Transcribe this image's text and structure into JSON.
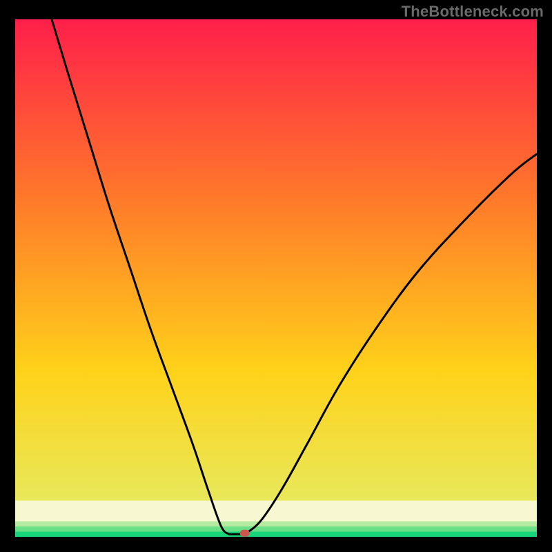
{
  "watermark": "TheBottleneck.com",
  "colors": {
    "black": "#000000",
    "curve": "#000000",
    "marker_fill": "#c8584e",
    "band_cream": "#f7f7d2",
    "band_green": "#17d57a",
    "grad_top": "#ff1f4a",
    "grad_mid1": "#ff7a2a",
    "grad_mid2": "#ffd21a",
    "grad_low": "#e8e85a"
  },
  "chart_data": {
    "type": "line",
    "title": "",
    "xlabel": "",
    "ylabel": "",
    "xlim": [
      0,
      100
    ],
    "ylim": [
      0,
      100
    ],
    "series": [
      {
        "name": "bottleneck-curve-left",
        "x": [
          7,
          10,
          14,
          18,
          22,
          26,
          30,
          34,
          37,
          39.5,
          41
        ],
        "y": [
          100,
          90,
          77,
          64,
          52,
          40,
          29,
          18,
          9,
          2,
          0.5
        ]
      },
      {
        "name": "bottleneck-curve-right",
        "x": [
          44,
          47,
          51,
          56,
          62,
          69,
          77,
          86,
          95,
          100
        ],
        "y": [
          0.5,
          3,
          9,
          18,
          29,
          40,
          51,
          61,
          70,
          74
        ]
      },
      {
        "name": "flat-bottom",
        "x": [
          41,
          44
        ],
        "y": [
          0.5,
          0.5
        ]
      }
    ],
    "marker": {
      "x": 44,
      "y": 0.7
    },
    "background_bands": [
      {
        "from_y": 0,
        "to_y": 1.0,
        "color": "#17d57a"
      },
      {
        "from_y": 1.0,
        "to_y": 2.0,
        "color": "#6adf86"
      },
      {
        "from_y": 2.0,
        "to_y": 3.0,
        "color": "#b6eaa0"
      },
      {
        "from_y": 3.0,
        "to_y": 7.0,
        "color": "#f7f7d2"
      }
    ]
  }
}
